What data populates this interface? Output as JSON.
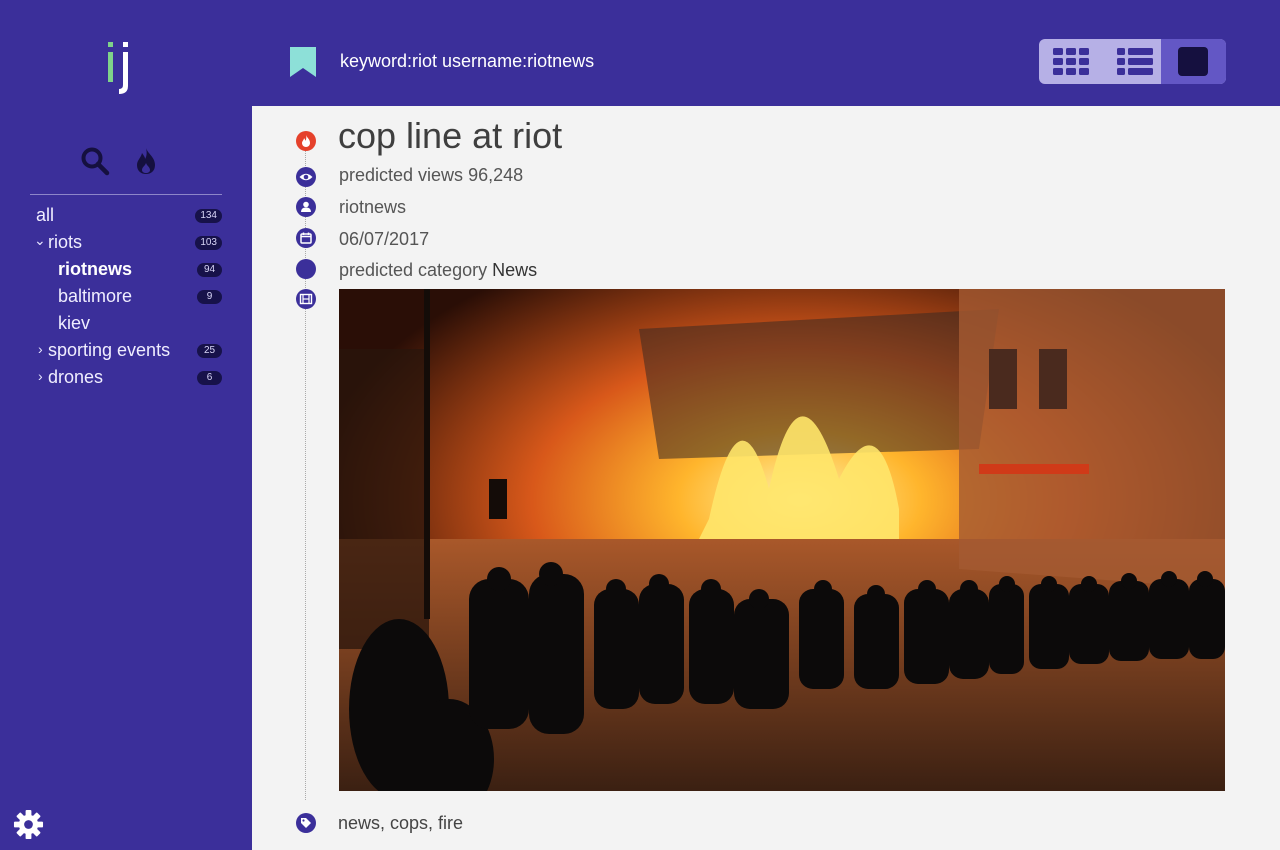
{
  "header": {
    "query": "keyword:riot username:riotnews",
    "views": [
      "grid-view-icon",
      "list-view-icon",
      "single-view-icon"
    ]
  },
  "sidebar": {
    "tools": [
      "search-icon",
      "fire-icon"
    ],
    "items": [
      {
        "label": "all",
        "count": "134"
      },
      {
        "label": "riots",
        "count": "103",
        "chevron": "⌄"
      },
      {
        "label": "riotnews",
        "count": "94"
      },
      {
        "label": "baltimore",
        "count": "9"
      },
      {
        "label": "kiev",
        "count": ""
      },
      {
        "label": "sporting events",
        "count": "25",
        "chevron": "›"
      },
      {
        "label": "drones",
        "count": "6",
        "chevron": "›"
      }
    ]
  },
  "post": {
    "title": "cop line at riot",
    "views_prefix": "predicted views",
    "views": "96,248",
    "username": "riotnews",
    "date": "06/07/2017",
    "category_prefix": "predicted category",
    "category": "News",
    "tags": "news, cops, fire"
  },
  "colors": {
    "primary": "#3b2f9a",
    "badge": "#17124a",
    "hot": "#e5412b",
    "bookmark": "#8de0d8",
    "logo_dot": "#7fd28a"
  }
}
